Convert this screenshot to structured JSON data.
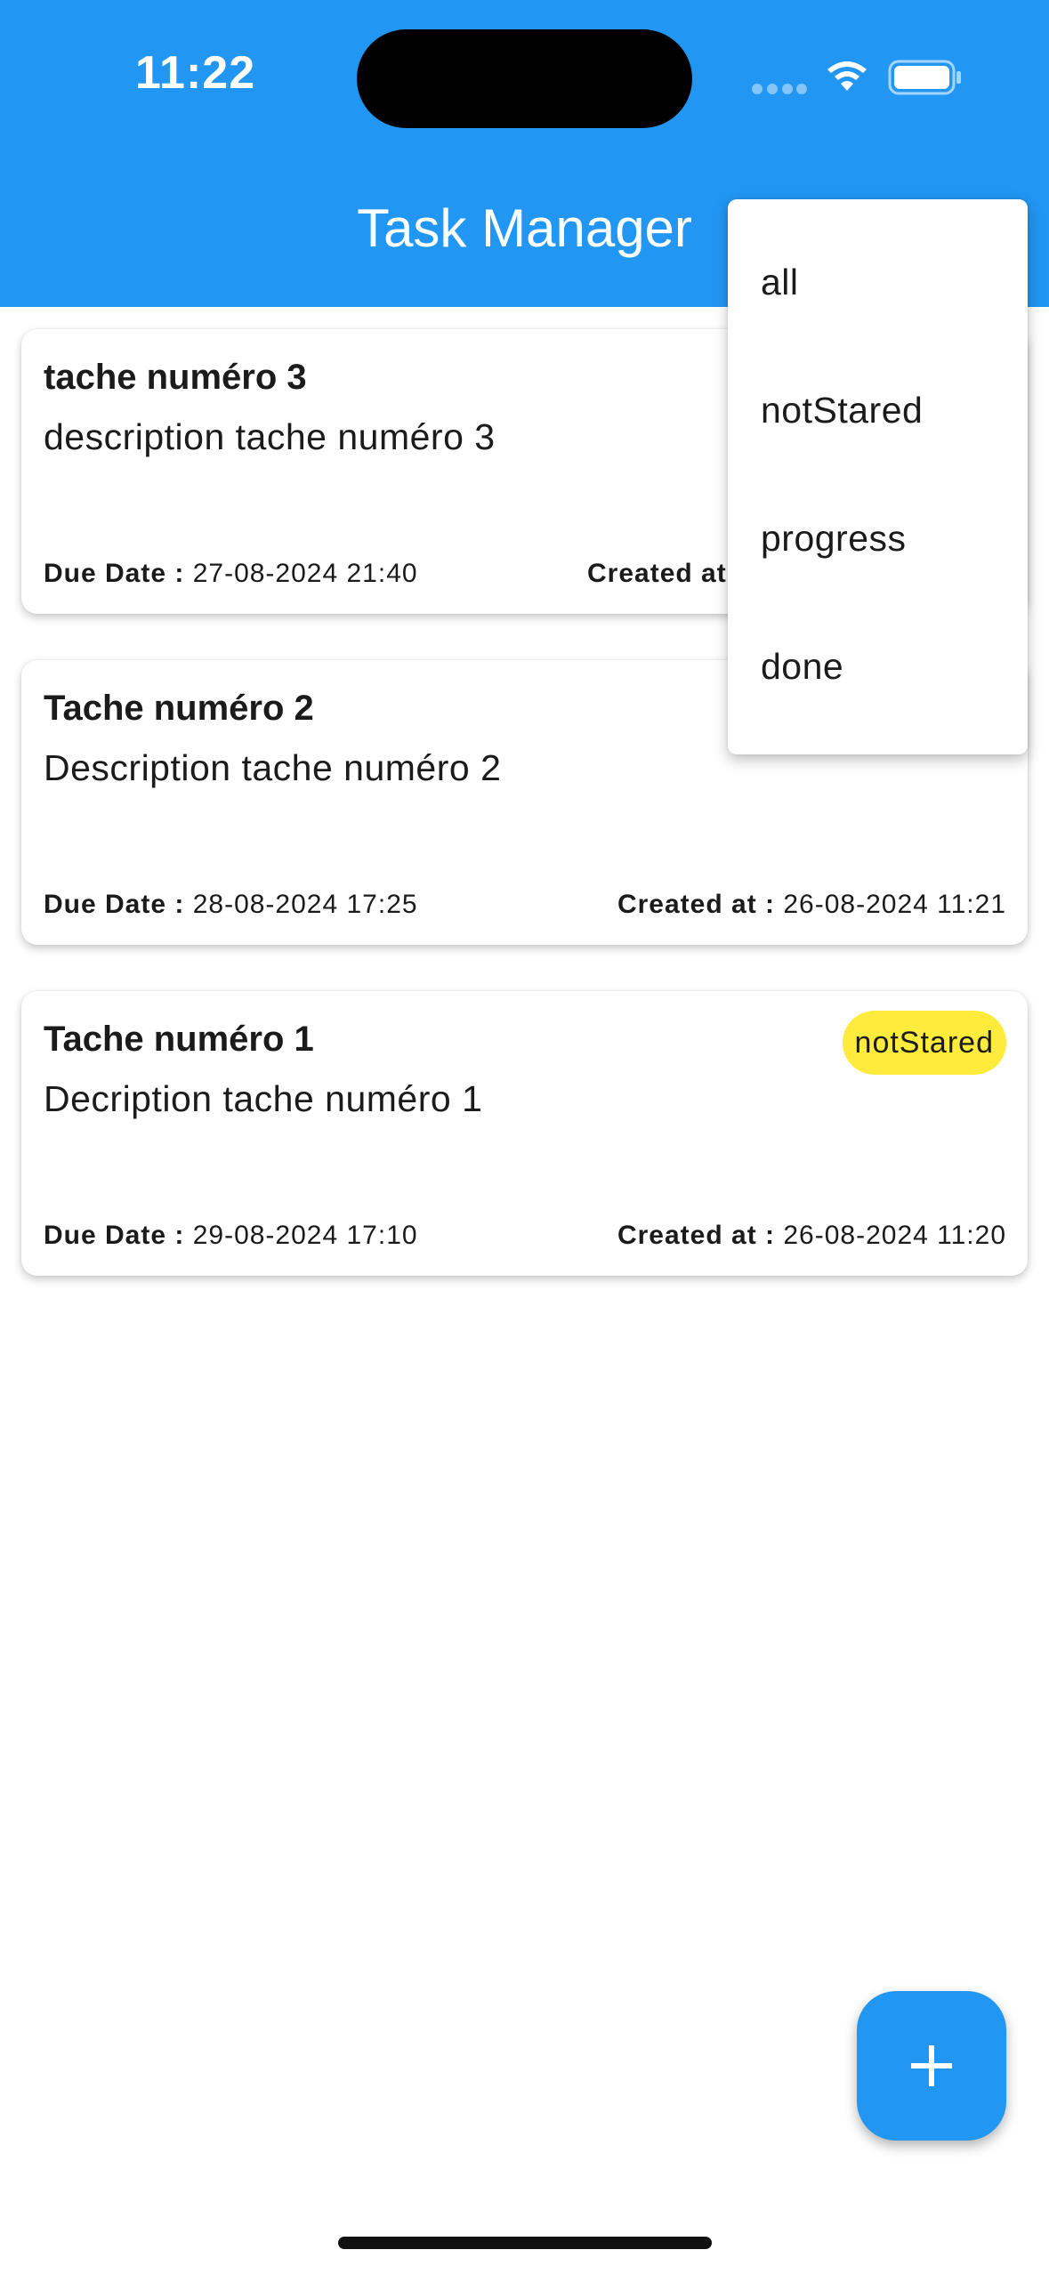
{
  "status_bar": {
    "time": "11:22"
  },
  "appbar": {
    "title": "Task Manager"
  },
  "tasks": [
    {
      "title": "tache numéro 3",
      "description": "description tache numéro 3",
      "due_label": "Due Date :",
      "due_value": "27-08-2024 21:40",
      "created_label": "Created at :",
      "created_value": ""
    },
    {
      "title": "Tache numéro 2",
      "description": "Description tache numéro 2",
      "due_label": "Due Date :",
      "due_value": "28-08-2024 17:25",
      "created_label": "Created at :",
      "created_value": "26-08-2024 11:21"
    },
    {
      "title": "Tache numéro 1",
      "description": "Decription tache numéro 1",
      "status": "notStared",
      "due_label": "Due Date :",
      "due_value": "29-08-2024 17:10",
      "created_label": "Created at :",
      "created_value": "26-08-2024 11:20"
    }
  ],
  "filter_menu": {
    "options": [
      "all",
      "notStared",
      "progress",
      "done"
    ]
  },
  "fab": {
    "icon": "plus-icon"
  },
  "colors": {
    "primary": "#2196f3",
    "badge_notstarted": "#ffeb3b"
  }
}
